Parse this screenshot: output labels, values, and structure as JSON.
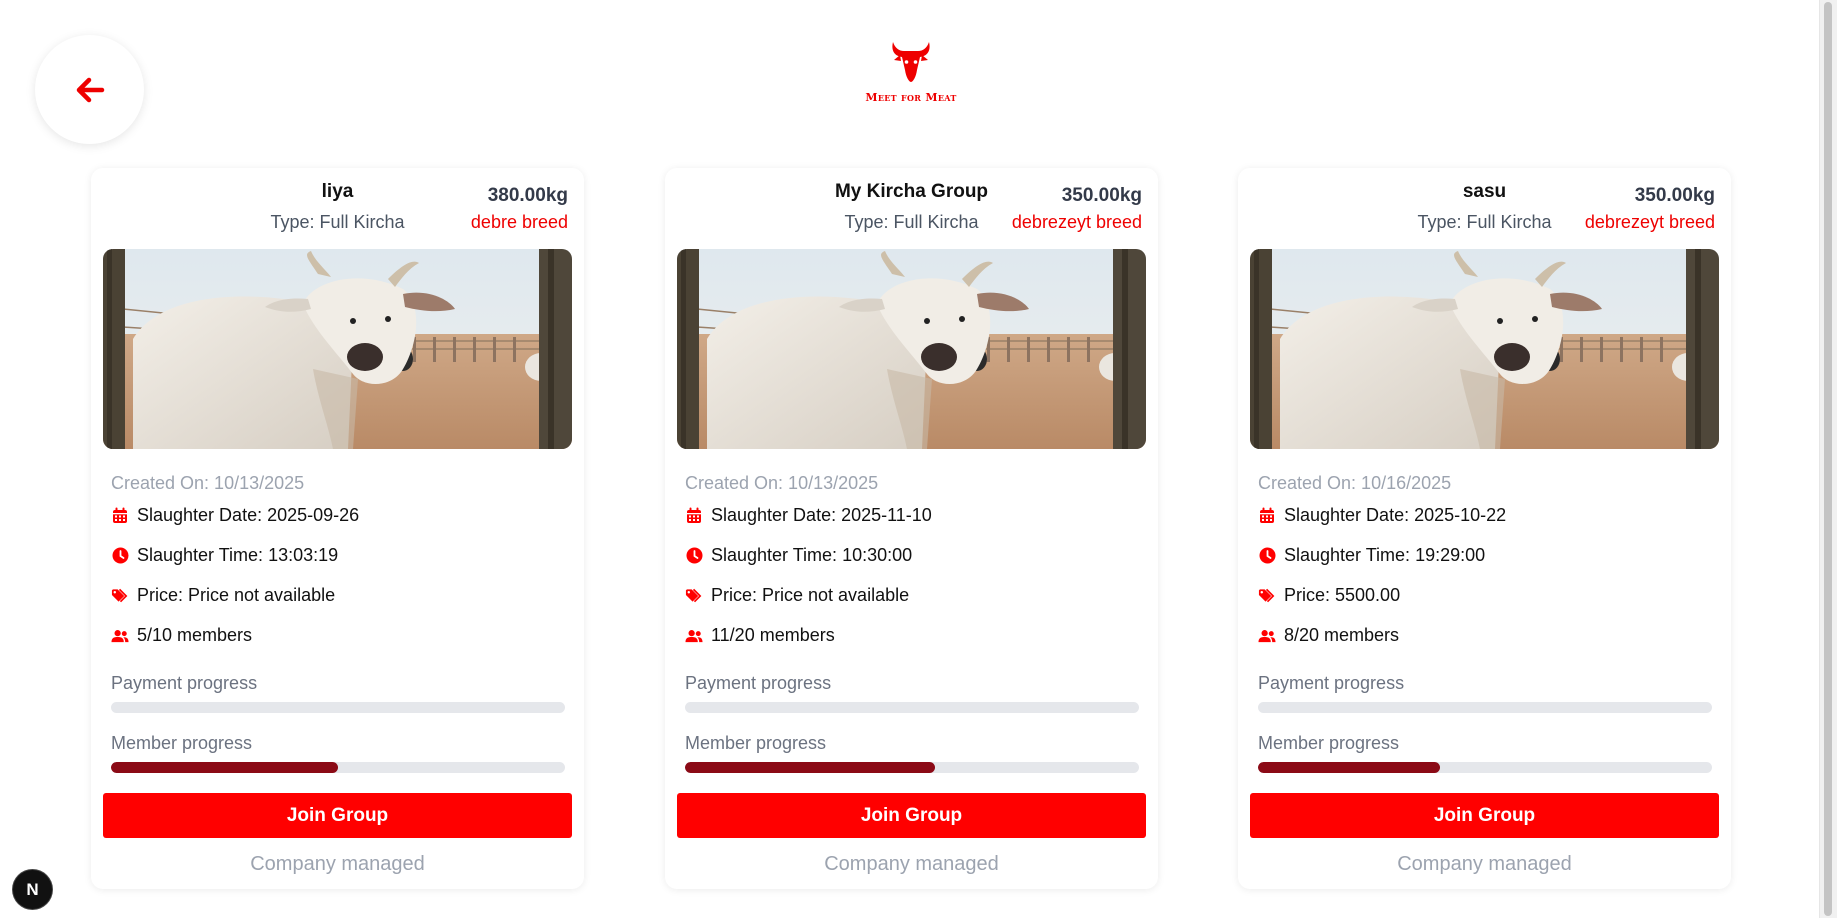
{
  "header": {
    "back_icon": "arrow-left-icon",
    "logo_text": "Meet for Meat"
  },
  "colors": {
    "brand_red": "#ff0000",
    "progress_fill": "#8b0a16",
    "progress_track": "#e5e7eb"
  },
  "labels": {
    "payment_progress": "Payment progress",
    "member_progress": "Member progress",
    "join_button": "Join Group",
    "managed": "Company managed"
  },
  "cards": [
    {
      "name": "liya",
      "weight": "380.00kg",
      "type": "Type: Full Kircha",
      "breed": "debre breed",
      "created": "Created On: 10/13/2025",
      "slaughter_date": "Slaughter Date: 2025-09-26",
      "slaughter_time": "Slaughter Time: 13:03:19",
      "price": "Price: Price not available",
      "members": "5/10 members",
      "payment_progress": 0,
      "member_progress": 0.5
    },
    {
      "name": "My Kircha Group",
      "weight": "350.00kg",
      "type": "Type: Full Kircha",
      "breed": "debrezeyt breed",
      "created": "Created On: 10/13/2025",
      "slaughter_date": "Slaughter Date: 2025-11-10",
      "slaughter_time": "Slaughter Time: 10:30:00",
      "price": "Price: Price not available",
      "members": "11/20 members",
      "payment_progress": 0,
      "member_progress": 0.55
    },
    {
      "name": "sasu",
      "weight": "350.00kg",
      "type": "Type: Full Kircha",
      "breed": "debrezeyt breed",
      "created": "Created On: 10/16/2025",
      "slaughter_date": "Slaughter Date: 2025-10-22",
      "slaughter_time": "Slaughter Time: 19:29:00",
      "price": "Price: 5500.00",
      "members": "8/20 members",
      "payment_progress": 0,
      "member_progress": 0.4
    }
  ],
  "dev_badge": "N"
}
